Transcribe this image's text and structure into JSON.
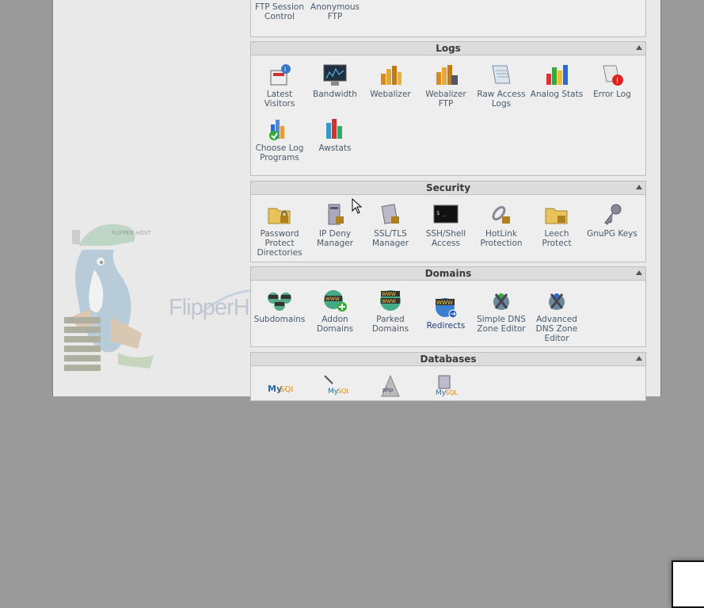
{
  "top_partial": {
    "items": [
      {
        "label": "FTP Session Control",
        "icon": "ftp-session-icon"
      },
      {
        "label": "Anonymous FTP",
        "icon": "anonymous-ftp-icon"
      }
    ]
  },
  "logs": {
    "title": "Logs",
    "items": [
      {
        "label": "Latest Visitors",
        "icon": "latest-visitors-icon"
      },
      {
        "label": "Bandwidth",
        "icon": "bandwidth-icon"
      },
      {
        "label": "Webalizer",
        "icon": "webalizer-icon"
      },
      {
        "label": "Webalizer FTP",
        "icon": "webalizer-ftp-icon"
      },
      {
        "label": "Raw Access Logs",
        "icon": "raw-access-logs-icon"
      },
      {
        "label": "Analog Stats",
        "icon": "analog-stats-icon"
      },
      {
        "label": "Error Log",
        "icon": "error-log-icon"
      },
      {
        "label": "Choose Log Programs",
        "icon": "choose-log-programs-icon"
      },
      {
        "label": "Awstats",
        "icon": "awstats-icon"
      }
    ]
  },
  "security": {
    "title": "Security",
    "items": [
      {
        "label": "Password Protect Directories",
        "icon": "password-protect-icon"
      },
      {
        "label": "IP Deny Manager",
        "icon": "ip-deny-icon"
      },
      {
        "label": "SSL/TLS Manager",
        "icon": "ssl-tls-icon"
      },
      {
        "label": "SSH/Shell Access",
        "icon": "ssh-shell-icon"
      },
      {
        "label": "HotLink Protection",
        "icon": "hotlink-icon"
      },
      {
        "label": "Leech Protect",
        "icon": "leech-protect-icon"
      },
      {
        "label": "GnuPG Keys",
        "icon": "gnupg-keys-icon"
      }
    ]
  },
  "domains": {
    "title": "Domains",
    "items": [
      {
        "label": "Subdomains",
        "icon": "subdomains-icon"
      },
      {
        "label": "Addon Domains",
        "icon": "addon-domains-icon"
      },
      {
        "label": "Parked Domains",
        "icon": "parked-domains-icon"
      },
      {
        "label": "Redirects",
        "icon": "redirects-icon"
      },
      {
        "label": "Simple DNS Zone Editor",
        "icon": "simple-dns-icon"
      },
      {
        "label": "Advanced DNS Zone Editor",
        "icon": "advanced-dns-icon"
      }
    ]
  },
  "databases": {
    "title": "Databases"
  },
  "brand": {
    "name": "FlipperHost",
    "tagline": "",
    "cap_text": "FLIPPER HOST"
  },
  "colors": {
    "accent_blue": "#2a5db0",
    "link_text": "#4a5a6a",
    "panel_bg": "#eeeeee"
  }
}
